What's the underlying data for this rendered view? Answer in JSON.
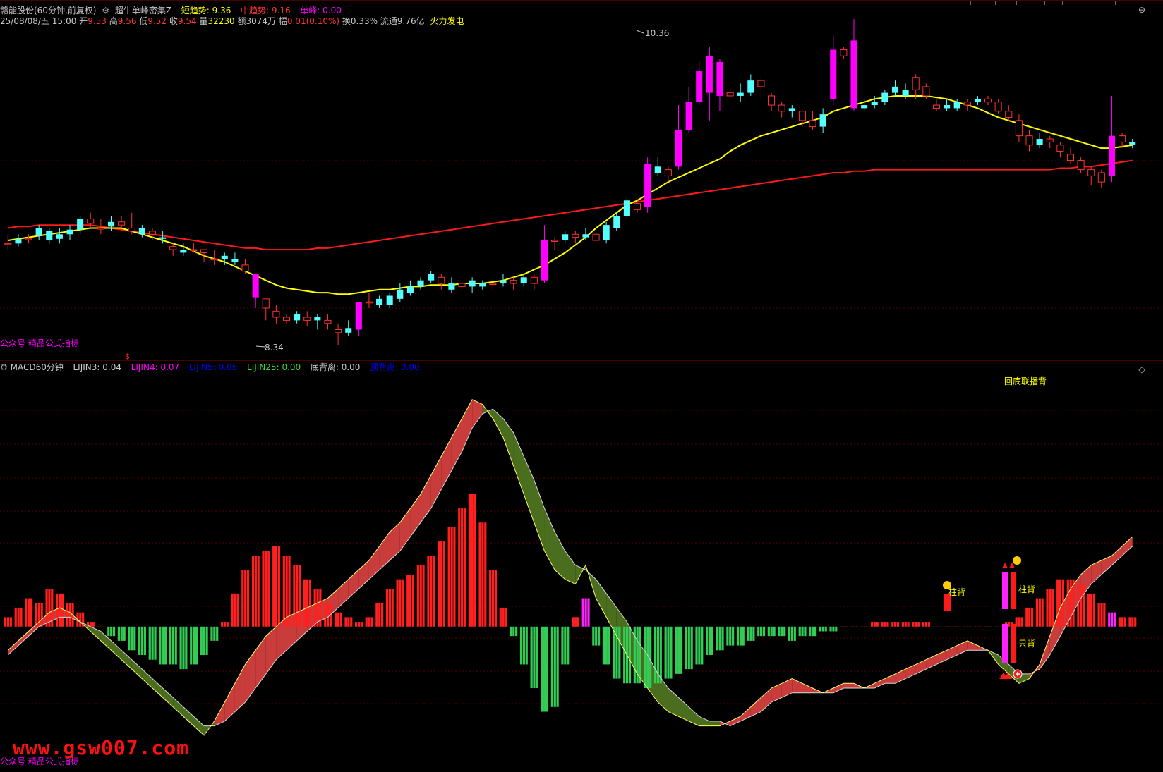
{
  "header": {
    "stock_title": "赣能股份(60分钟,前复权)",
    "indicator_name": "超牛单峰密集Z",
    "short_trend_label": "短趋势:",
    "short_trend_value": "9.36",
    "mid_trend_label": "中趋势:",
    "mid_trend_value": "9.16",
    "single_peak_label": "单峰:",
    "single_peak_value": "0.00"
  },
  "quote": {
    "date": "25/08/08/五 15:00",
    "open_label": "开",
    "open": "9.53",
    "high_label": "高",
    "high": "9.56",
    "low_label": "低",
    "low": "9.52",
    "close_label": "收",
    "close": "9.54",
    "volume_label": "量",
    "volume": "32230",
    "amount_label": "额",
    "amount": "3074万",
    "change_label": "幅",
    "change": "0.01(0.10%)",
    "turnover_label": "换",
    "turnover": "0.33%",
    "float_label": "流通",
    "float": "9.76亿",
    "sector": "火力发电"
  },
  "markers": {
    "price_high": "10.36",
    "price_low": "8.34",
    "dollar": "$"
  },
  "watermark_top": "公众号 精品公式指标",
  "watermark_bottom": "公众号 精品公式指标",
  "site_watermark": "www.gsw007.com",
  "macd_header": {
    "name": "MACD60分钟",
    "lijin3_label": "LIJIN3:",
    "lijin3": "0.04",
    "lijin4_label": "LIJIN4:",
    "lijin4": "0.07",
    "lijin5_label": "LIJIN5:",
    "lijin5": "0.05",
    "lijin25_label": "LIJIN25:",
    "lijin25": "0.00",
    "bottom_div_label": "底背离:",
    "bottom_div": "0.00",
    "top_div_label": "顶背离:",
    "top_div": "0.00"
  },
  "signals": {
    "overlap_text": "回底联播背",
    "zhu_bei_1": "柱背",
    "zhu_bei_2": "柱背",
    "zhi_bei": "只背"
  },
  "colors": {
    "up": "#ff3232",
    "down": "#54ffff",
    "strong": "#ff00ff",
    "ma_short": "#ffff00",
    "ma_long": "#ff1a1a",
    "fill_up": "#c83c3c",
    "fill_down": "#4a6e1e",
    "hist_up": "#ff2020",
    "hist_down": "#33cc55",
    "hist_strong": "#ff22ff"
  },
  "chart_data": [
    {
      "type": "candlestick",
      "title": "赣能股份(60分钟,前复权)",
      "ylim": [
        8.3,
        10.4
      ],
      "x_count": 110,
      "labels": {
        "max": 10.36,
        "min": 8.34
      },
      "candles": [
        [
          9.0,
          9.0,
          9.06,
          8.96
        ],
        [
          9.03,
          9.0,
          9.06,
          8.98
        ],
        [
          9.03,
          9.03,
          9.06,
          9.0
        ],
        [
          9.1,
          9.05,
          9.12,
          9.02
        ],
        [
          9.08,
          9.02,
          9.1,
          9.0
        ],
        [
          9.06,
          9.03,
          9.1,
          9.0
        ],
        [
          9.09,
          9.06,
          9.12,
          9.02
        ],
        [
          9.16,
          9.09,
          9.18,
          9.06
        ],
        [
          9.13,
          9.16,
          9.2,
          9.1
        ],
        [
          9.1,
          9.1,
          9.16,
          9.06
        ],
        [
          9.14,
          9.11,
          9.18,
          9.08
        ],
        [
          9.12,
          9.14,
          9.18,
          9.1
        ],
        [
          9.08,
          9.1,
          9.2,
          9.06
        ],
        [
          9.1,
          9.06,
          9.12,
          9.04
        ],
        [
          9.06,
          9.08,
          9.1,
          9.02
        ],
        [
          9.04,
          9.03,
          9.08,
          9.0
        ],
        [
          8.96,
          8.98,
          9.0,
          8.92
        ],
        [
          8.96,
          8.94,
          9.0,
          8.92
        ],
        [
          8.96,
          8.96,
          9.0,
          8.94
        ],
        [
          8.94,
          8.96,
          8.96,
          8.88
        ],
        [
          8.9,
          8.9,
          8.96,
          8.86
        ],
        [
          8.92,
          8.9,
          8.94,
          8.86
        ],
        [
          8.9,
          8.88,
          8.94,
          8.86
        ],
        [
          8.82,
          8.86,
          8.9,
          8.8
        ],
        [
          8.65,
          8.8,
          8.8,
          8.58
        ],
        [
          8.58,
          8.64,
          8.64,
          8.5
        ],
        [
          8.52,
          8.56,
          8.6,
          8.48
        ],
        [
          8.5,
          8.52,
          8.54,
          8.48
        ],
        [
          8.54,
          8.5,
          8.56,
          8.48
        ],
        [
          8.5,
          8.52,
          8.56,
          8.46
        ],
        [
          8.52,
          8.5,
          8.54,
          8.44
        ],
        [
          8.48,
          8.5,
          8.54,
          8.44
        ],
        [
          8.42,
          8.44,
          8.48,
          8.34
        ],
        [
          8.45,
          8.42,
          8.5,
          8.4
        ],
        [
          8.62,
          8.44,
          8.62,
          8.4
        ],
        [
          8.62,
          8.62,
          8.68,
          8.58
        ],
        [
          8.64,
          8.6,
          8.66,
          8.58
        ],
        [
          8.66,
          8.6,
          8.68,
          8.58
        ],
        [
          8.7,
          8.64,
          8.74,
          8.62
        ],
        [
          8.72,
          8.68,
          8.76,
          8.66
        ],
        [
          8.76,
          8.72,
          8.78,
          8.7
        ],
        [
          8.8,
          8.76,
          8.82,
          8.74
        ],
        [
          8.74,
          8.78,
          8.8,
          8.7
        ],
        [
          8.74,
          8.7,
          8.78,
          8.68
        ],
        [
          8.72,
          8.74,
          8.76,
          8.7
        ],
        [
          8.76,
          8.72,
          8.78,
          8.68
        ],
        [
          8.74,
          8.72,
          8.76,
          8.7
        ],
        [
          8.74,
          8.74,
          8.78,
          8.7
        ],
        [
          8.76,
          8.74,
          8.8,
          8.72
        ],
        [
          8.74,
          8.76,
          8.78,
          8.7
        ],
        [
          8.78,
          8.74,
          8.8,
          8.72
        ],
        [
          8.74,
          8.78,
          8.8,
          8.7
        ],
        [
          9.02,
          8.76,
          9.12,
          8.74
        ],
        [
          9.02,
          9.02,
          9.04,
          8.96
        ],
        [
          9.06,
          9.02,
          9.08,
          9.0
        ],
        [
          9.04,
          9.06,
          9.08,
          9.0
        ],
        [
          9.06,
          9.04,
          9.1,
          9.02
        ],
        [
          9.02,
          9.06,
          9.08,
          9.0
        ],
        [
          9.12,
          9.02,
          9.14,
          9.0
        ],
        [
          9.18,
          9.1,
          9.2,
          9.08
        ],
        [
          9.28,
          9.18,
          9.3,
          9.16
        ],
        [
          9.22,
          9.26,
          9.28,
          9.2
        ],
        [
          9.52,
          9.24,
          9.56,
          9.2
        ],
        [
          9.5,
          9.46,
          9.56,
          9.44
        ],
        [
          9.44,
          9.48,
          9.5,
          9.4
        ],
        [
          9.74,
          9.5,
          9.9,
          9.48
        ],
        [
          9.92,
          9.74,
          10.02,
          9.72
        ],
        [
          10.12,
          9.92,
          10.18,
          9.9
        ],
        [
          10.22,
          9.98,
          10.28,
          9.8
        ],
        [
          9.96,
          10.18,
          10.2,
          9.86
        ],
        [
          9.96,
          9.98,
          10.02,
          9.94
        ],
        [
          9.98,
          9.96,
          10.04,
          9.92
        ],
        [
          10.06,
          9.98,
          10.1,
          9.96
        ],
        [
          10.02,
          10.06,
          10.1,
          9.94
        ],
        [
          9.9,
          9.96,
          9.98,
          9.86
        ],
        [
          9.86,
          9.9,
          9.92,
          9.82
        ],
        [
          9.88,
          9.86,
          9.9,
          9.82
        ],
        [
          9.8,
          9.86,
          9.86,
          9.76
        ],
        [
          9.76,
          9.8,
          9.86,
          9.74
        ],
        [
          9.84,
          9.76,
          9.88,
          9.72
        ],
        [
          10.26,
          9.94,
          10.36,
          9.9
        ],
        [
          10.22,
          10.26,
          10.28,
          10.2
        ],
        [
          9.88,
          10.32,
          10.46,
          9.86
        ],
        [
          9.9,
          9.88,
          9.94,
          9.86
        ],
        [
          9.92,
          9.9,
          9.96,
          9.88
        ],
        [
          9.98,
          9.92,
          10.0,
          9.9
        ],
        [
          10.02,
          9.98,
          10.06,
          9.96
        ],
        [
          10.0,
          9.96,
          10.04,
          9.94
        ],
        [
          10.0,
          10.08,
          10.1,
          9.94
        ],
        [
          9.96,
          10.02,
          10.04,
          9.94
        ],
        [
          9.88,
          9.9,
          9.94,
          9.86
        ],
        [
          9.9,
          9.88,
          9.94,
          9.86
        ],
        [
          9.92,
          9.88,
          9.94,
          9.86
        ],
        [
          9.9,
          9.92,
          9.94,
          9.86
        ],
        [
          9.94,
          9.92,
          9.96,
          9.9
        ],
        [
          9.92,
          9.94,
          9.96,
          9.9
        ],
        [
          9.86,
          9.92,
          9.94,
          9.84
        ],
        [
          9.82,
          9.86,
          9.9,
          9.8
        ],
        [
          9.7,
          9.8,
          9.84,
          9.66
        ],
        [
          9.64,
          9.7,
          9.74,
          9.6
        ],
        [
          9.68,
          9.64,
          9.72,
          9.62
        ],
        [
          9.66,
          9.68,
          9.7,
          9.62
        ],
        [
          9.6,
          9.64,
          9.66,
          9.56
        ],
        [
          9.54,
          9.58,
          9.62,
          9.52
        ],
        [
          9.48,
          9.54,
          9.56,
          9.46
        ],
        [
          9.44,
          9.48,
          9.5,
          9.38
        ],
        [
          9.4,
          9.46,
          9.48,
          9.36
        ],
        [
          9.7,
          9.44,
          9.96,
          9.4
        ],
        [
          9.66,
          9.7,
          9.72,
          9.62
        ],
        [
          9.66,
          9.64,
          9.68,
          9.62
        ]
      ],
      "ma_short": [
        9.02,
        9.03,
        9.04,
        9.05,
        9.06,
        9.07,
        9.08,
        9.09,
        9.1,
        9.1,
        9.1,
        9.1,
        9.08,
        9.06,
        9.04,
        9.02,
        9.0,
        8.98,
        8.95,
        8.92,
        8.9,
        8.88,
        8.85,
        8.82,
        8.79,
        8.76,
        8.73,
        8.71,
        8.7,
        8.69,
        8.68,
        8.68,
        8.67,
        8.67,
        8.68,
        8.69,
        8.7,
        8.7,
        8.71,
        8.72,
        8.72,
        8.73,
        8.73,
        8.73,
        8.74,
        8.74,
        8.74,
        8.75,
        8.76,
        8.78,
        8.8,
        8.83,
        8.86,
        8.9,
        8.94,
        8.99,
        9.04,
        9.1,
        9.15,
        9.2,
        9.25,
        9.28,
        9.32,
        9.36,
        9.4,
        9.43,
        9.46,
        9.49,
        9.52,
        9.55,
        9.6,
        9.64,
        9.67,
        9.7,
        9.72,
        9.74,
        9.76,
        9.78,
        9.8,
        9.82,
        9.86,
        9.88,
        9.9,
        9.92,
        9.94,
        9.95,
        9.96,
        9.96,
        9.96,
        9.96,
        9.95,
        9.94,
        9.92,
        9.9,
        9.88,
        9.85,
        9.82,
        9.8,
        9.78,
        9.76,
        9.74,
        9.72,
        9.7,
        9.68,
        9.66,
        9.64,
        9.62,
        9.62,
        9.63,
        9.64
      ],
      "ma_long": [
        9.1,
        9.11,
        9.11,
        9.12,
        9.12,
        9.12,
        9.12,
        9.12,
        9.12,
        9.11,
        9.1,
        9.09,
        9.08,
        9.07,
        9.06,
        9.05,
        9.04,
        9.03,
        9.02,
        9.01,
        9.0,
        8.99,
        8.98,
        8.97,
        8.97,
        8.96,
        8.96,
        8.96,
        8.96,
        8.96,
        8.97,
        8.97,
        8.98,
        8.99,
        9.0,
        9.01,
        9.02,
        9.03,
        9.04,
        9.05,
        9.06,
        9.07,
        9.08,
        9.09,
        9.1,
        9.11,
        9.12,
        9.13,
        9.14,
        9.15,
        9.16,
        9.17,
        9.18,
        9.19,
        9.2,
        9.21,
        9.22,
        9.23,
        9.24,
        9.25,
        9.26,
        9.27,
        9.28,
        9.29,
        9.3,
        9.31,
        9.32,
        9.33,
        9.34,
        9.35,
        9.36,
        9.37,
        9.38,
        9.39,
        9.4,
        9.41,
        9.42,
        9.43,
        9.44,
        9.45,
        9.46,
        9.46,
        9.47,
        9.47,
        9.48,
        9.48,
        9.48,
        9.48,
        9.48,
        9.48,
        9.48,
        9.48,
        9.48,
        9.48,
        9.48,
        9.48,
        9.48,
        9.48,
        9.48,
        9.48,
        9.48,
        9.48,
        9.49,
        9.49,
        9.5,
        9.5,
        9.51,
        9.52,
        9.53,
        9.54
      ]
    },
    {
      "type": "bar",
      "title": "MACD60分钟",
      "ylim": [
        -0.3,
        0.52
      ],
      "x_count": 110,
      "dif": [
        -0.05,
        -0.03,
        -0.01,
        0.01,
        0.03,
        0.04,
        0.03,
        0.01,
        -0.01,
        -0.03,
        -0.05,
        -0.07,
        -0.09,
        -0.11,
        -0.13,
        -0.15,
        -0.17,
        -0.19,
        -0.21,
        -0.23,
        -0.2,
        -0.16,
        -0.12,
        -0.08,
        -0.05,
        -0.02,
        0.0,
        0.02,
        0.03,
        0.04,
        0.05,
        0.06,
        0.08,
        0.1,
        0.12,
        0.14,
        0.17,
        0.2,
        0.22,
        0.25,
        0.28,
        0.32,
        0.36,
        0.4,
        0.44,
        0.48,
        0.47,
        0.44,
        0.4,
        0.34,
        0.28,
        0.22,
        0.16,
        0.12,
        0.1,
        0.09,
        0.13,
        0.06,
        0.02,
        -0.02,
        -0.06,
        -0.1,
        -0.13,
        -0.16,
        -0.18,
        -0.19,
        -0.2,
        -0.21,
        -0.21,
        -0.21,
        -0.2,
        -0.19,
        -0.17,
        -0.15,
        -0.13,
        -0.12,
        -0.11,
        -0.12,
        -0.13,
        -0.14,
        -0.13,
        -0.12,
        -0.12,
        -0.13,
        -0.12,
        -0.11,
        -0.1,
        -0.09,
        -0.08,
        -0.07,
        -0.06,
        -0.05,
        -0.04,
        -0.03,
        -0.04,
        -0.05,
        -0.08,
        -0.1,
        -0.12,
        -0.11,
        -0.08,
        -0.02,
        0.04,
        0.08,
        0.11,
        0.13,
        0.14,
        0.15,
        0.17,
        0.19
      ],
      "dea": [
        -0.06,
        -0.04,
        -0.02,
        0.0,
        0.01,
        0.02,
        0.02,
        0.01,
        0.0,
        -0.01,
        -0.03,
        -0.05,
        -0.07,
        -0.09,
        -0.11,
        -0.13,
        -0.15,
        -0.17,
        -0.19,
        -0.21,
        -0.21,
        -0.2,
        -0.18,
        -0.16,
        -0.13,
        -0.1,
        -0.07,
        -0.05,
        -0.03,
        -0.01,
        0.01,
        0.02,
        0.04,
        0.06,
        0.08,
        0.1,
        0.12,
        0.14,
        0.16,
        0.19,
        0.22,
        0.25,
        0.29,
        0.33,
        0.37,
        0.42,
        0.45,
        0.46,
        0.44,
        0.41,
        0.36,
        0.31,
        0.25,
        0.2,
        0.16,
        0.13,
        0.12,
        0.1,
        0.07,
        0.04,
        0.01,
        -0.03,
        -0.06,
        -0.1,
        -0.13,
        -0.15,
        -0.17,
        -0.19,
        -0.2,
        -0.2,
        -0.21,
        -0.2,
        -0.19,
        -0.18,
        -0.16,
        -0.15,
        -0.14,
        -0.14,
        -0.14,
        -0.14,
        -0.14,
        -0.13,
        -0.13,
        -0.13,
        -0.13,
        -0.12,
        -0.12,
        -0.11,
        -0.1,
        -0.09,
        -0.08,
        -0.07,
        -0.06,
        -0.05,
        -0.05,
        -0.05,
        -0.06,
        -0.08,
        -0.1,
        -0.1,
        -0.09,
        -0.06,
        -0.02,
        0.02,
        0.06,
        0.09,
        0.11,
        0.13,
        0.15,
        0.17
      ],
      "hist": [
        0.02,
        0.04,
        0.06,
        0.05,
        0.08,
        0.07,
        0.05,
        0.03,
        0.01,
        0.0,
        -0.02,
        -0.03,
        -0.05,
        -0.06,
        -0.07,
        -0.08,
        -0.08,
        -0.09,
        -0.08,
        -0.06,
        -0.03,
        0.01,
        0.07,
        0.12,
        0.15,
        0.16,
        0.17,
        0.15,
        0.13,
        0.1,
        0.08,
        0.05,
        0.03,
        0.02,
        0.01,
        0.02,
        0.05,
        0.08,
        0.1,
        0.11,
        0.13,
        0.15,
        0.18,
        0.21,
        0.25,
        0.28,
        0.22,
        0.12,
        0.04,
        -0.02,
        -0.08,
        -0.13,
        -0.18,
        -0.17,
        -0.08,
        0.02,
        0.06,
        -0.04,
        -0.08,
        -0.11,
        -0.12,
        -0.12,
        -0.13,
        -0.12,
        -0.11,
        -0.1,
        -0.09,
        -0.08,
        -0.06,
        -0.05,
        -0.04,
        -0.04,
        -0.03,
        -0.02,
        -0.02,
        -0.02,
        -0.03,
        -0.02,
        -0.02,
        -0.01,
        -0.01,
        0.0,
        0.0,
        0.0,
        0.01,
        0.01,
        0.01,
        0.01,
        0.01,
        0.01,
        0.0,
        0.0,
        0.0,
        0.0,
        0.0,
        0.0,
        0.0,
        0.01,
        0.02,
        0.04,
        0.06,
        0.08,
        0.1,
        0.1,
        0.09,
        0.07,
        0.05,
        0.03,
        0.02,
        0.02
      ]
    }
  ]
}
